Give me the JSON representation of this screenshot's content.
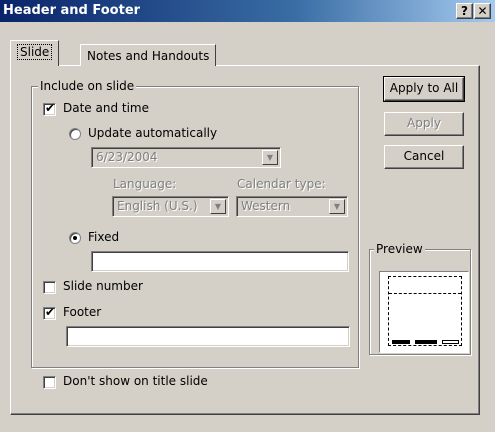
{
  "window": {
    "title": "Header and Footer",
    "help_label": "?",
    "close_label": "✕"
  },
  "tabs": [
    {
      "label": "Slide",
      "active": true
    },
    {
      "label": "Notes and Handouts",
      "active": false
    }
  ],
  "include_group": {
    "legend": "Include on slide",
    "date_time": {
      "label": "Date and time",
      "checked": true
    },
    "update_auto": {
      "label": "Update automatically",
      "selected": false
    },
    "date_value": "6/23/2004",
    "language_label": "Language:",
    "language_value": "English (U.S.)",
    "calendar_label": "Calendar type:",
    "calendar_value": "Western",
    "fixed": {
      "label": "Fixed",
      "selected": true,
      "value": ""
    },
    "slide_number": {
      "label": "Slide number",
      "checked": false
    },
    "footer": {
      "label": "Footer",
      "checked": true,
      "value": ""
    }
  },
  "dont_show_title": {
    "label": "Don't show on title slide",
    "checked": false
  },
  "buttons": {
    "apply_all": "Apply to All",
    "apply": "Apply",
    "cancel": "Cancel"
  },
  "preview": {
    "legend": "Preview"
  },
  "icons": {
    "check": "✔",
    "dropdown": "▼"
  }
}
